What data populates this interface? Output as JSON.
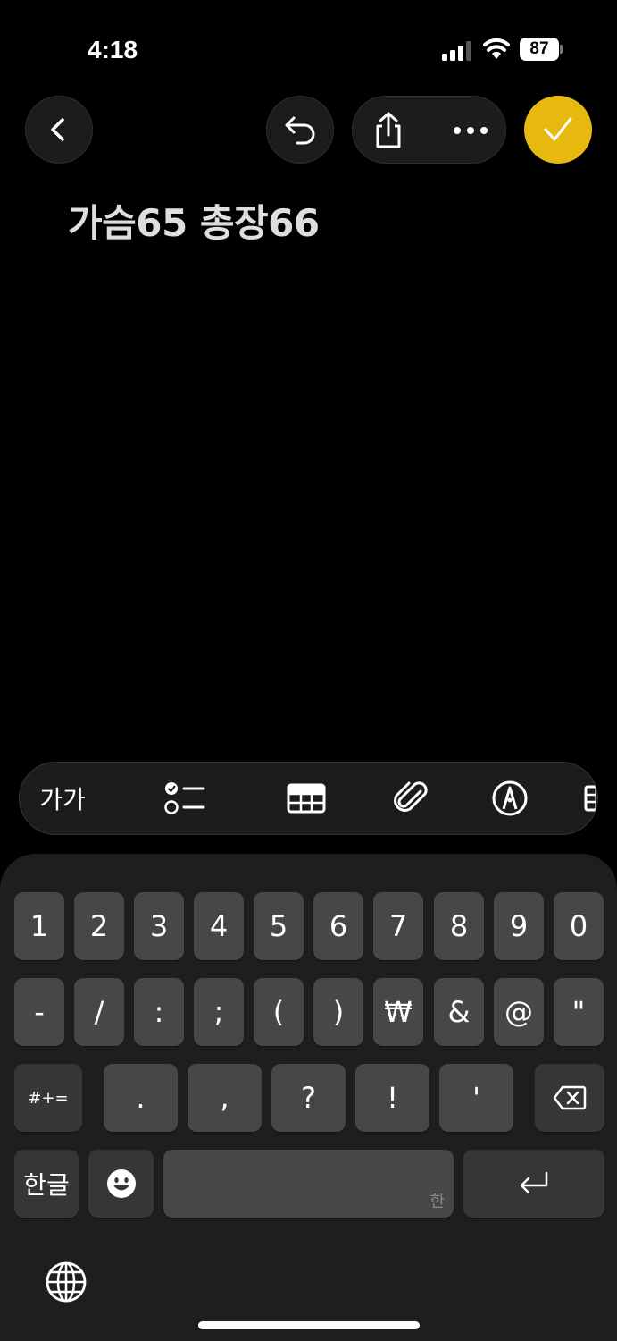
{
  "status_bar": {
    "time": "4:18",
    "battery": "87"
  },
  "note": {
    "title": "가슴65 총장66"
  },
  "toolbar": {
    "text_style_label": "가가"
  },
  "keyboard": {
    "row1": [
      "1",
      "2",
      "3",
      "4",
      "5",
      "6",
      "7",
      "8",
      "9",
      "0"
    ],
    "row2": [
      "-",
      "/",
      ":",
      ";",
      "(",
      ")",
      "₩",
      "&",
      "@",
      "\""
    ],
    "row3_mode": "#+=",
    "row3": [
      ".",
      ",",
      "?",
      "!",
      "'"
    ],
    "lang_key": "한글",
    "space_hint": "한"
  },
  "colors": {
    "accent": "#e7b90e",
    "key": "#474747",
    "key_func": "#363636"
  }
}
